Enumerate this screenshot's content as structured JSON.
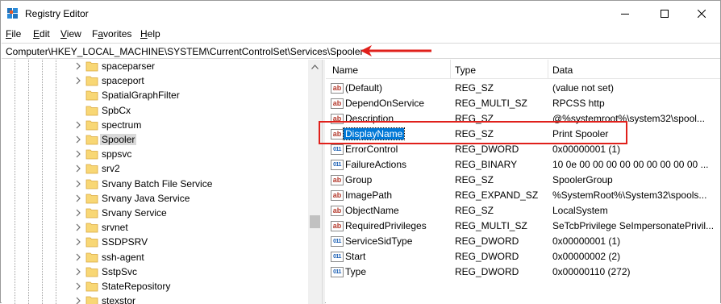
{
  "window": {
    "title": "Registry Editor"
  },
  "menu": [
    {
      "label": "File",
      "key": "F",
      "rest": "ile"
    },
    {
      "label": "Edit",
      "key": "E",
      "rest": "dit"
    },
    {
      "label": "View",
      "key": "V",
      "rest": "iew"
    },
    {
      "label": "Favorites",
      "key": "a",
      "pre": "F",
      "rest": "vorites"
    },
    {
      "label": "Help",
      "key": "H",
      "rest": "elp"
    }
  ],
  "address": {
    "path": "Computer\\HKEY_LOCAL_MACHINE\\SYSTEM\\CurrentControlSet\\Services\\Spooler"
  },
  "tree": {
    "items": [
      {
        "label": "spaceparser",
        "expandable": true
      },
      {
        "label": "spaceport",
        "expandable": true
      },
      {
        "label": "SpatialGraphFilter",
        "expandable": false
      },
      {
        "label": "SpbCx",
        "expandable": false
      },
      {
        "label": "spectrum",
        "expandable": true
      },
      {
        "label": "Spooler",
        "expandable": true,
        "selected": true
      },
      {
        "label": "sppsvc",
        "expandable": true
      },
      {
        "label": "srv2",
        "expandable": true
      },
      {
        "label": "Srvany Batch File Service",
        "expandable": true
      },
      {
        "label": "Srvany Java Service",
        "expandable": true
      },
      {
        "label": "Srvany Service",
        "expandable": true
      },
      {
        "label": "srvnet",
        "expandable": true
      },
      {
        "label": "SSDPSRV",
        "expandable": true
      },
      {
        "label": "ssh-agent",
        "expandable": true
      },
      {
        "label": "SstpSvc",
        "expandable": true
      },
      {
        "label": "StateRepository",
        "expandable": true
      },
      {
        "label": "stexstor",
        "expandable": true
      }
    ]
  },
  "list": {
    "headers": {
      "name": "Name",
      "type": "Type",
      "data": "Data"
    },
    "rows": [
      {
        "icon": "string-value-icon",
        "name": "(Default)",
        "type": "REG_SZ",
        "data": "(value not set)"
      },
      {
        "icon": "string-value-icon",
        "name": "DependOnService",
        "type": "REG_MULTI_SZ",
        "data": "RPCSS http"
      },
      {
        "icon": "string-value-icon",
        "name": "Description",
        "type": "REG_SZ",
        "data": "@%systemroot%\\system32\\spool..."
      },
      {
        "icon": "string-value-icon",
        "name": "DisplayName",
        "type": "REG_SZ",
        "data": "Print Spooler",
        "selected": true
      },
      {
        "icon": "binary-value-icon",
        "name": "ErrorControl",
        "type": "REG_DWORD",
        "data": "0x00000001 (1)"
      },
      {
        "icon": "binary-value-icon",
        "name": "FailureActions",
        "type": "REG_BINARY",
        "data": "10 0e 00 00 00 00 00 00 00 00 00 ..."
      },
      {
        "icon": "string-value-icon",
        "name": "Group",
        "type": "REG_SZ",
        "data": "SpoolerGroup"
      },
      {
        "icon": "string-value-icon",
        "name": "ImagePath",
        "type": "REG_EXPAND_SZ",
        "data": "%SystemRoot%\\System32\\spools..."
      },
      {
        "icon": "string-value-icon",
        "name": "ObjectName",
        "type": "REG_SZ",
        "data": "LocalSystem"
      },
      {
        "icon": "string-value-icon",
        "name": "RequiredPrivileges",
        "type": "REG_MULTI_SZ",
        "data": "SeTcbPrivilege SeImpersonatePrivil..."
      },
      {
        "icon": "binary-value-icon",
        "name": "ServiceSidType",
        "type": "REG_DWORD",
        "data": "0x00000001 (1)"
      },
      {
        "icon": "binary-value-icon",
        "name": "Start",
        "type": "REG_DWORD",
        "data": "0x00000002 (2)"
      },
      {
        "icon": "binary-value-icon",
        "name": "Type",
        "type": "REG_DWORD",
        "data": "0x00000110 (272)"
      }
    ]
  },
  "colors": {
    "selection": "#0078d7",
    "annotation": "#e0201b",
    "folder": "#f5c85a"
  }
}
